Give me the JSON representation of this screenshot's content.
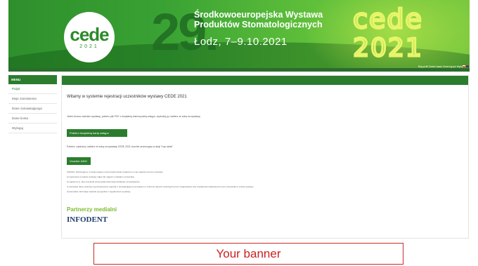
{
  "header": {
    "logo_word": "cede",
    "logo_year": "2021",
    "big_number": "29.",
    "expo_title": "Środkowoeuropejska Wystawa Produktów Stomatologicznych",
    "expo_date": "Łodz, 7–9.10.2021",
    "decor_logo_top": "cede",
    "decor_logo_bottom": "2021"
  },
  "top_strip": {
    "links_text": "Mój profil  Zmień hasło  Zmień język  Wyloguj"
  },
  "sidebar": {
    "title": "MENU",
    "items": [
      {
        "label": "Pulpit",
        "active": true
      },
      {
        "label": "Moje zamówienia",
        "active": false
      },
      {
        "label": "Dane zamawiającego",
        "active": false
      },
      {
        "label": "Dane konta",
        "active": false
      },
      {
        "label": "Wyloguj",
        "active": false
      }
    ]
  },
  "main": {
    "welcome": "Witamy w systemie rejestracji uczestników wystawy CEDE 2021",
    "instruction": "Jeżeli chcesz zwiedzić wystawę, pobierz plik PDF z bezpłatną imienną kartą wstępu, wydrukuj ją i zabierz ze sobą na wystawę.",
    "download_button": "Pobierz bezpłatną kartę wstępu",
    "note": "Pobierz, wydrukuj i zabierz ze sobą na wystawę CEDE 2021 voucher promocyjny w akcji \"Łap rabat\"",
    "voucher_button": "Voucher #400",
    "fine_print": [
      "UWAGA: Zastrzegamy, iż kartę wstępu można wykorzystać wyłącznie w celu wejścia na teren wystawy.",
      "a) wykonanie w trakcie wystawy zdjęć lub nagrań z udziałem uczestnika.",
      "b) zgoda na to, aby uczestnik otrzymywał informacje handlowe od wystawców.",
      "c) wszystkie dane osobowe są przetwarzane zgodnie z obowiązującymi przepisami o ochronie danych osobowych przez Organizatora oraz wystawców wskazanych przez uczestnika w czasie wystawy.",
      "d) wszystkie informacje zawarte są zgodnie z regulaminem wystawy."
    ],
    "partners_heading": "Partnerzy medialni",
    "partner_name": "INFODENT"
  },
  "banner": {
    "text": "Your banner"
  },
  "colors": {
    "accent_green": "#2b7d2d",
    "header_green": "#3aa334",
    "partners_green": "#7cba2f",
    "banner_red": "#cc1f1f"
  }
}
